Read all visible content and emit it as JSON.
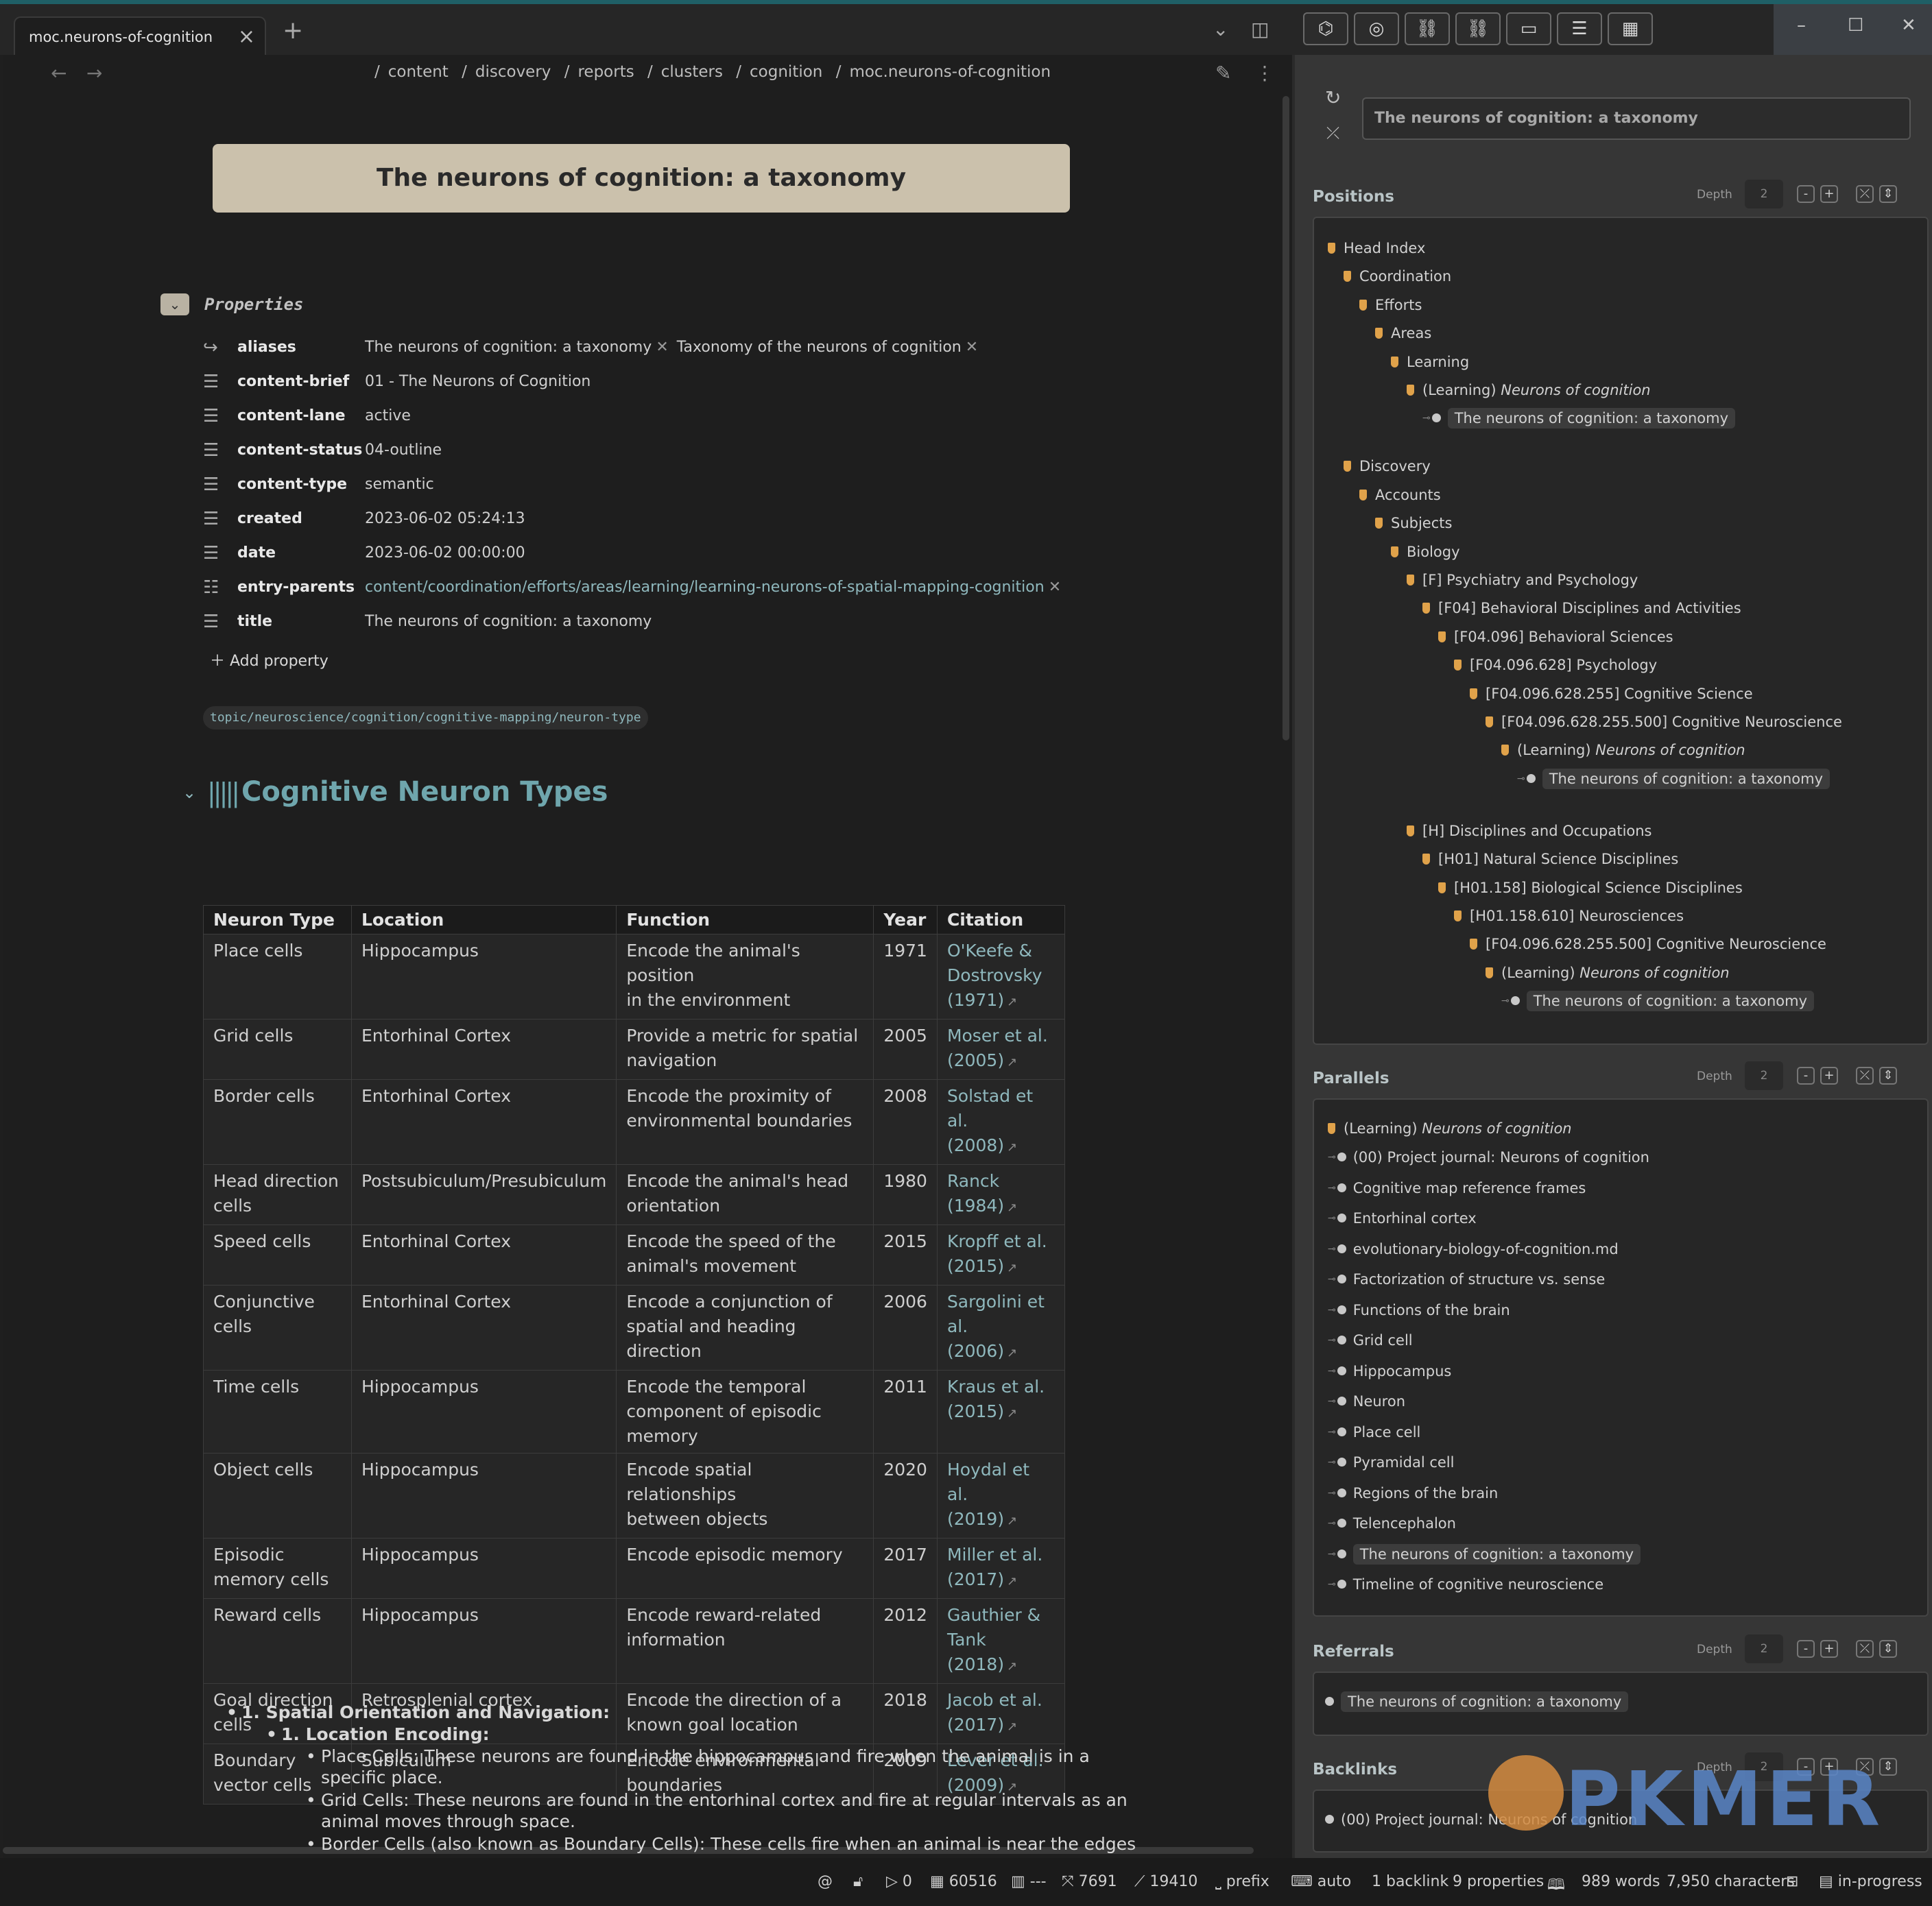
{
  "tab": {
    "title": "moc.neurons-of-cognition"
  },
  "breadcrumbs": [
    "content",
    "discovery",
    "reports",
    "clusters",
    "cognition",
    "moc.neurons-of-cognition"
  ],
  "note_title": "The neurons of cognition: a taxonomy",
  "properties": {
    "label": "Properties",
    "rows": [
      {
        "key": "aliases",
        "values": [
          "The neurons of cognition: a taxonomy",
          "Taxonomy of the neurons of cognition"
        ]
      },
      {
        "key": "content-brief",
        "value": "01 - The Neurons of Cognition"
      },
      {
        "key": "content-lane",
        "value": "active"
      },
      {
        "key": "content-status",
        "value": "04-outline"
      },
      {
        "key": "content-type",
        "value": "semantic"
      },
      {
        "key": "created",
        "value": "2023-06-02 05:24:13"
      },
      {
        "key": "date",
        "value": "2023-06-02 00:00:00"
      },
      {
        "key": "entry-parents",
        "value": "content/coordination/efforts/areas/learning/learning-neurons-of-spatial-mapping-cognition"
      },
      {
        "key": "title",
        "value": "The neurons of cognition: a taxonomy"
      }
    ],
    "add_label": "Add property"
  },
  "tag": "topic/neuroscience/cognition/cognitive-mapping/neuron-type",
  "heading": "Cognitive Neuron Types",
  "table": {
    "headers": [
      "Neuron Type",
      "Location",
      "Function",
      "Year",
      "Citation"
    ],
    "rows": [
      {
        "type": [
          "Place cells"
        ],
        "loc": [
          "Hippocampus"
        ],
        "func": [
          "Encode the animal's position",
          "in the environment"
        ],
        "year": "1971",
        "cite": [
          "O'Keefe &",
          "Dostrovsky",
          "(1971)"
        ]
      },
      {
        "type": [
          "Grid cells"
        ],
        "loc": [
          "Entorhinal Cortex"
        ],
        "func": [
          "Provide a metric for spatial",
          "navigation"
        ],
        "year": "2005",
        "cite": [
          "Moser et al.",
          "(2005)"
        ]
      },
      {
        "type": [
          "Border cells"
        ],
        "loc": [
          "Entorhinal Cortex"
        ],
        "func": [
          "Encode the proximity of",
          "environmental boundaries"
        ],
        "year": "2008",
        "cite": [
          "Solstad et al.",
          "(2008)"
        ]
      },
      {
        "type": [
          "Head direction",
          "cells"
        ],
        "loc": [
          "Postsubiculum/Presubiculum"
        ],
        "func": [
          "Encode the animal's head",
          "orientation"
        ],
        "year": "1980",
        "cite": [
          "Ranck (1984)"
        ]
      },
      {
        "type": [
          "Speed cells"
        ],
        "loc": [
          "Entorhinal Cortex"
        ],
        "func": [
          "Encode the speed of the",
          "animal's movement"
        ],
        "year": "2015",
        "cite": [
          "Kropff et al.",
          "(2015)"
        ]
      },
      {
        "type": [
          "Conjunctive",
          "cells"
        ],
        "loc": [
          "Entorhinal Cortex"
        ],
        "func": [
          "Encode a conjunction of",
          "spatial and heading direction"
        ],
        "year": "2006",
        "cite": [
          "Sargolini et al.",
          "(2006)"
        ]
      },
      {
        "type": [
          "Time cells"
        ],
        "loc": [
          "Hippocampus"
        ],
        "func": [
          "Encode the temporal",
          "component of episodic",
          "memory"
        ],
        "year": "2011",
        "cite": [
          "Kraus et al.",
          "(2015)"
        ]
      },
      {
        "type": [
          "Object cells"
        ],
        "loc": [
          "Hippocampus"
        ],
        "func": [
          "Encode spatial relationships",
          "between objects"
        ],
        "year": "2020",
        "cite": [
          "Hoydal et al.",
          "(2019)"
        ]
      },
      {
        "type": [
          "Episodic",
          "memory cells"
        ],
        "loc": [
          "Hippocampus"
        ],
        "func": [
          "Encode episodic memory"
        ],
        "year": "2017",
        "cite": [
          "Miller et al.",
          "(2017)"
        ]
      },
      {
        "type": [
          "Reward cells"
        ],
        "loc": [
          "Hippocampus"
        ],
        "func": [
          "Encode reward-related",
          "information"
        ],
        "year": "2012",
        "cite": [
          "Gauthier & Tank",
          "(2018)"
        ]
      },
      {
        "type": [
          "Goal direction",
          "cells"
        ],
        "loc": [
          "Retrosplenial cortex"
        ],
        "func": [
          "Encode the direction of a",
          "known goal location"
        ],
        "year": "2018",
        "cite": [
          "Jacob et al.",
          "(2017)"
        ]
      },
      {
        "type": [
          "Boundary",
          "vector cells"
        ],
        "loc": [
          "Subiculum"
        ],
        "func": [
          "Encode environmental",
          "boundaries"
        ],
        "year": "2009",
        "cite": [
          "Lever et al.",
          "(2009)"
        ]
      }
    ]
  },
  "outline": {
    "l1": "1. Spatial Orientation and Navigation:",
    "l2": "1. Location Encoding:",
    "l3": [
      [
        "Place Cells: These neurons are found in the hippocampus and fire when the animal is in a",
        "specific place."
      ],
      [
        "Grid Cells: These neurons are found in the entorhinal cortex and fire at regular intervals as an",
        "animal moves through space."
      ],
      [
        "Border Cells (also known as Boundary Cells): These cells fire when an animal is near the edges"
      ]
    ]
  },
  "side": {
    "search_value": "The neurons of cognition: a taxonomy",
    "depth_label": "Depth",
    "depth_value": "2",
    "positions": {
      "title": "Positions",
      "nodes": [
        {
          "d": 0,
          "kind": "flag",
          "text": "Head Index"
        },
        {
          "d": 1,
          "kind": "flag",
          "text": "Coordination"
        },
        {
          "d": 2,
          "kind": "flag",
          "text": "Efforts"
        },
        {
          "d": 3,
          "kind": "flag",
          "text": "Areas"
        },
        {
          "d": 4,
          "kind": "flag",
          "text": "Learning"
        },
        {
          "d": 5,
          "kind": "flag",
          "text": "(Learning)",
          "em": "Neurons of cognition"
        },
        {
          "d": 6,
          "kind": "ball",
          "text": "The neurons of cognition: a taxonomy",
          "hl": true
        },
        {
          "d": 1,
          "kind": "flag",
          "text": "Discovery"
        },
        {
          "d": 2,
          "kind": "flag",
          "text": "Accounts"
        },
        {
          "d": 3,
          "kind": "flag",
          "text": "Subjects"
        },
        {
          "d": 4,
          "kind": "flag",
          "text": "Biology"
        },
        {
          "d": 5,
          "kind": "flag",
          "text": "[F] Psychiatry and Psychology"
        },
        {
          "d": 6,
          "kind": "flag",
          "text": "[F04] Behavioral Disciplines and Activities"
        },
        {
          "d": 7,
          "kind": "flag",
          "text": "[F04.096] Behavioral Sciences"
        },
        {
          "d": 8,
          "kind": "flag",
          "text": "[F04.096.628] Psychology"
        },
        {
          "d": 9,
          "kind": "flag",
          "text": "[F04.096.628.255] Cognitive Science"
        },
        {
          "d": 10,
          "kind": "flag",
          "text": "[F04.096.628.255.500] Cognitive Neuroscience"
        },
        {
          "d": 11,
          "kind": "flag",
          "text": "(Learning)",
          "em": "Neurons of cognition"
        },
        {
          "d": 12,
          "kind": "ball",
          "text": "The neurons of cognition: a taxonomy",
          "hl": true
        },
        {
          "d": 5,
          "kind": "flag",
          "text": "[H] Disciplines and Occupations"
        },
        {
          "d": 6,
          "kind": "flag",
          "text": "[H01] Natural Science Disciplines"
        },
        {
          "d": 7,
          "kind": "flag",
          "text": "[H01.158] Biological Science Disciplines"
        },
        {
          "d": 8,
          "kind": "flag",
          "text": "[H01.158.610] Neurosciences"
        },
        {
          "d": 9,
          "kind": "flag",
          "text": "[F04.096.628.255.500] Cognitive Neuroscience"
        },
        {
          "d": 10,
          "kind": "flag",
          "text": "(Learning)",
          "em": "Neurons of cognition"
        },
        {
          "d": 11,
          "kind": "ball",
          "text": "The neurons of cognition: a taxonomy",
          "hl": true
        }
      ]
    },
    "parallels": {
      "title": "Parallels",
      "root": {
        "text": "(Learning)",
        "em": "Neurons of cognition"
      },
      "items": [
        "(00) Project journal: Neurons of cognition",
        "Cognitive map reference frames",
        "Entorhinal cortex",
        "evolutionary-biology-of-cognition.md",
        "Factorization of structure vs. sense",
        "Functions of the brain",
        "Grid cell",
        "Hippocampus",
        "Neuron",
        "Place cell",
        "Pyramidal cell",
        "Regions of the brain",
        "Telencephalon",
        "The neurons of cognition: a taxonomy",
        "Timeline of cognitive neuroscience"
      ],
      "highlight_index": 13
    },
    "referrals": {
      "title": "Referrals",
      "items": [
        "The neurons of cognition: a taxonomy"
      ]
    },
    "backlinks": {
      "title": "Backlinks",
      "items": [
        "(00) Project journal: Neurons of cognition"
      ]
    }
  },
  "watermark": "PKMER",
  "status": {
    "num1": "0",
    "num2": "60516",
    "num3": "---",
    "num4": "7691",
    "num5": "19410",
    "prefix": "prefix",
    "auto": "auto",
    "backlinks": "1 backlink",
    "properties": "9 properties",
    "words": "989 words",
    "chars": "7,950 characters",
    "state": "in-progress"
  },
  "colors": {
    "title_bg": "#cbc1ac",
    "accent": "#6fa6ad",
    "flag": "#e0a24a"
  }
}
